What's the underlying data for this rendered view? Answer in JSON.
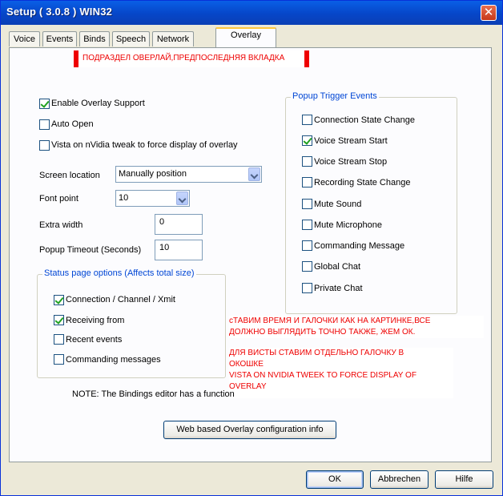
{
  "window": {
    "title": "Setup ( 3.0.8 ) WIN32",
    "close_symbol": "✕"
  },
  "tabs": [
    {
      "label": "Voice"
    },
    {
      "label": "Events"
    },
    {
      "label": "Binds"
    },
    {
      "label": "Speech"
    },
    {
      "label": "Network"
    },
    {
      "label": "Overlay",
      "active": true
    }
  ],
  "annotations": {
    "banner": "ПОДРАЗДЕЛ ОВЕРЛАЙ,ПРЕДПОСЛЕДНЯЯ ВКЛАДКА",
    "note_lines": [
      "сТАВИМ ВРЕМЯ И ГАЛОЧКИ КАК НА КАРТИНКЕ,ВСЕ",
      "ДОЛЖНО ВЫГЛЯДИТЬ ТОЧНО ТАКЖЕ, ЖЕМ ОК.",
      "ДЛЯ ВИСТЫ СТАВИМ ОТДЕЛЬНО ГАЛОЧКУ В",
      "ОКОШКЕ",
      "VISTA ON NVIDIA TWEEK TO FORCE DISPLAY OF",
      "OVERLAY"
    ],
    "color": "#e00000"
  },
  "overlay": {
    "enable_support": {
      "label": "Enable Overlay Support",
      "checked": true
    },
    "auto_open": {
      "label": "Auto Open",
      "checked": false
    },
    "vista_tweak": {
      "label": "Vista on nVidia tweak to force display of overlay",
      "checked": false
    },
    "screen_location": {
      "label": "Screen location",
      "value": "Manually position"
    },
    "font_point": {
      "label": "Font point",
      "value": "10"
    },
    "extra_width": {
      "label": "Extra width",
      "value": "0"
    },
    "popup_timeout": {
      "label": "Popup Timeout (Seconds)",
      "value": "10"
    }
  },
  "status_options": {
    "title": "Status page options (Affects total size)",
    "items": [
      {
        "label": "Connection / Channel / Xmit",
        "checked": true
      },
      {
        "label": "Receiving from",
        "checked": true
      },
      {
        "label": "Recent events",
        "checked": false
      },
      {
        "label": "Commanding messages",
        "checked": false
      }
    ]
  },
  "popup_events": {
    "title": "Popup Trigger Events",
    "items": [
      {
        "label": "Connection State Change",
        "checked": false
      },
      {
        "label": "Voice Stream Start",
        "checked": true
      },
      {
        "label": "Voice Stream Stop",
        "checked": false
      },
      {
        "label": "Recording State Change",
        "checked": false
      },
      {
        "label": "Mute Sound",
        "checked": false
      },
      {
        "label": "Mute Microphone",
        "checked": false
      },
      {
        "label": "Commanding Message",
        "checked": false
      },
      {
        "label": "Global Chat",
        "checked": false
      },
      {
        "label": "Private Chat",
        "checked": false
      }
    ]
  },
  "note": "NOTE: The Bindings editor has a function",
  "web_info_button": "Web based Overlay configuration info",
  "footer": {
    "ok": "OK",
    "cancel": "Abbrechen",
    "help": "Hilfe"
  }
}
